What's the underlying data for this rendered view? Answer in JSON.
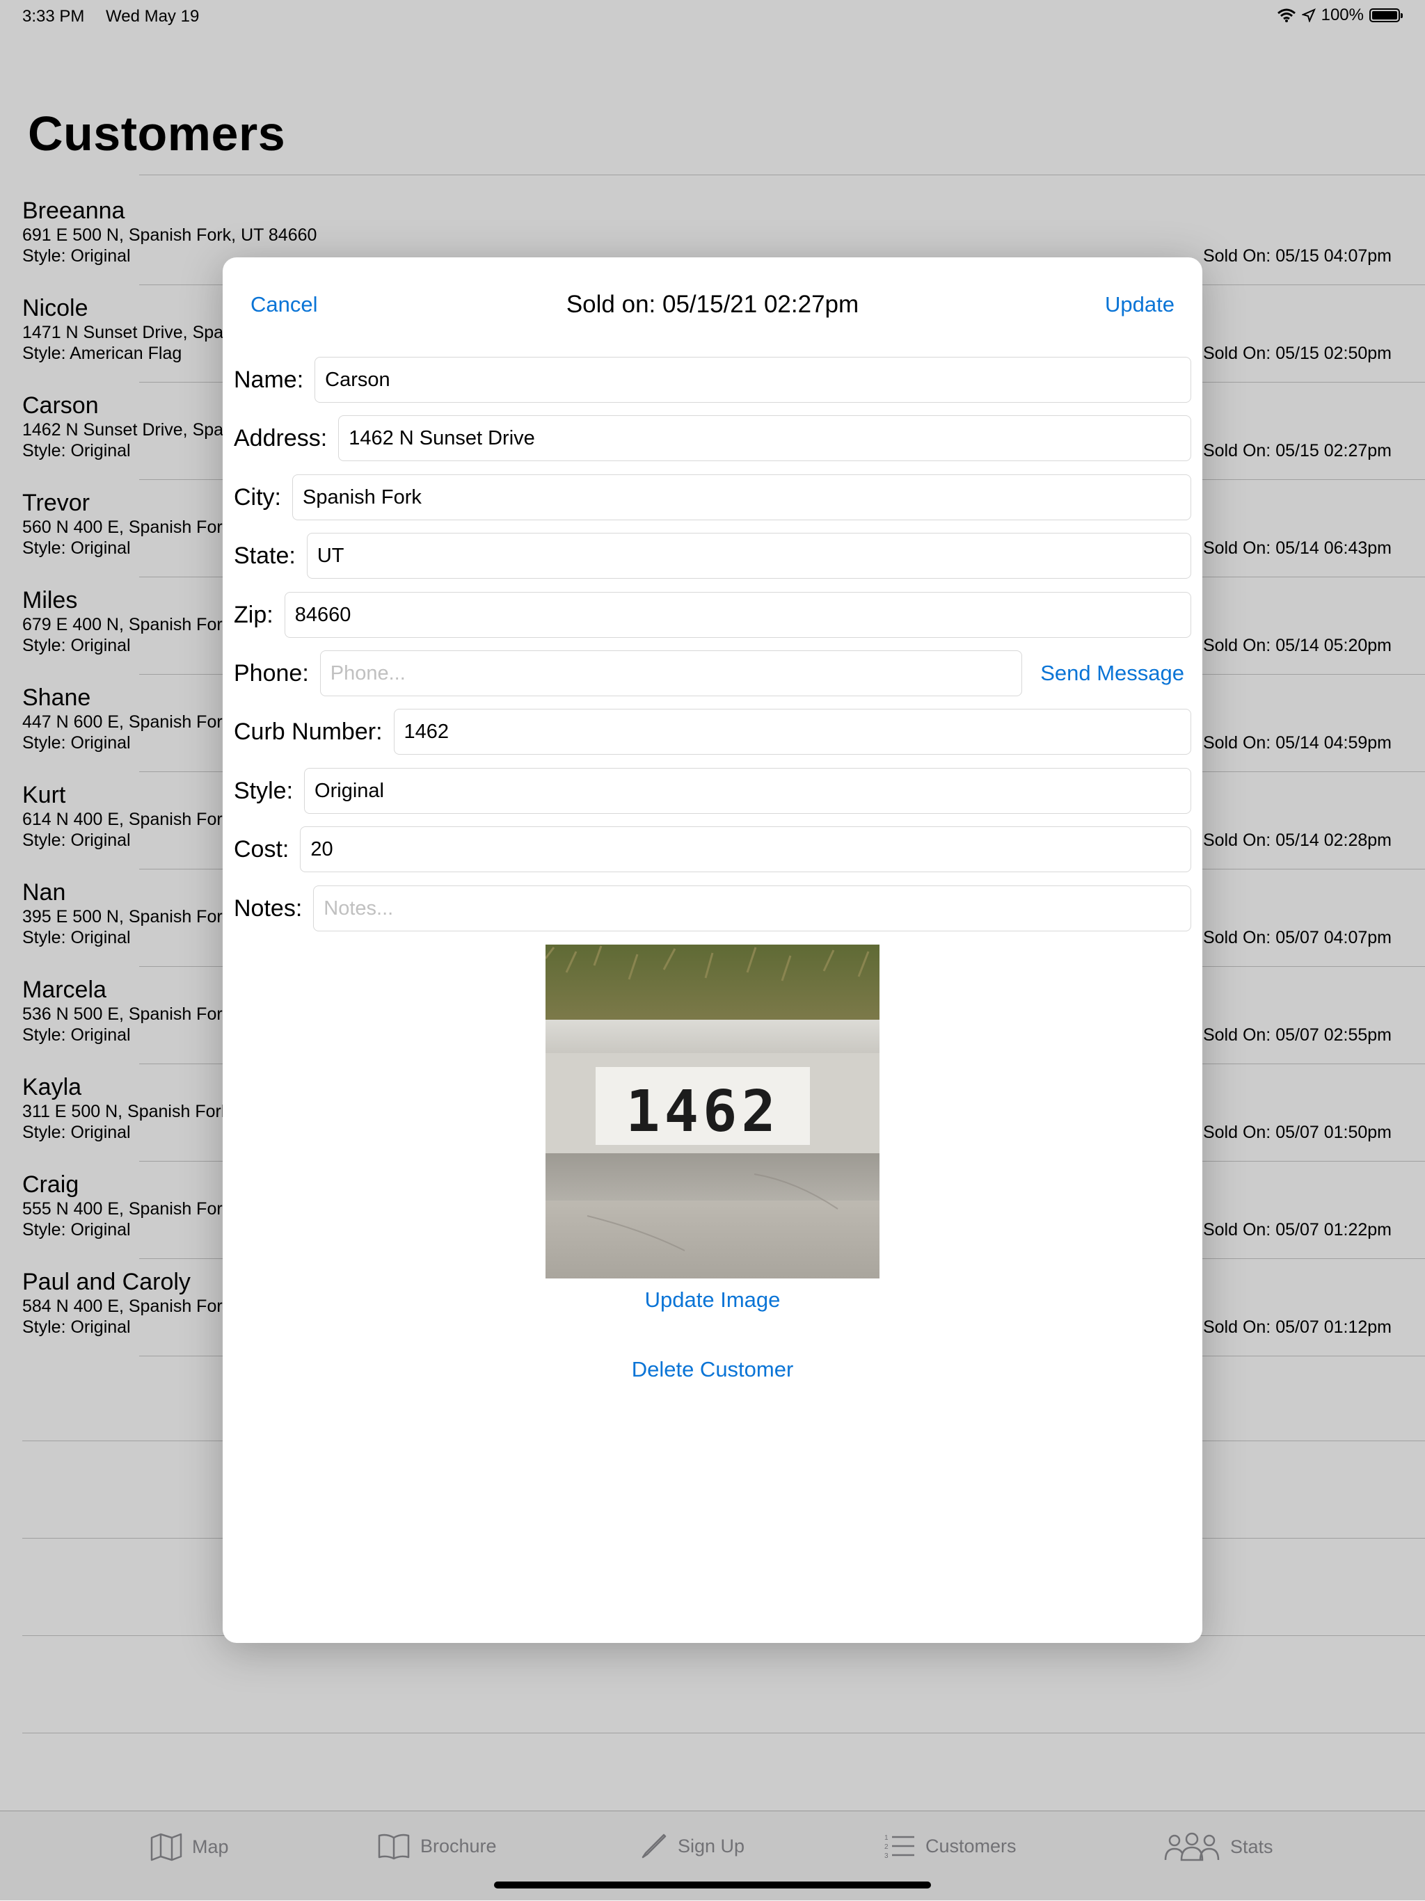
{
  "status_bar": {
    "time": "3:33 PM",
    "date": "Wed May 19",
    "battery": "100%"
  },
  "page": {
    "title": "Customers"
  },
  "customers": [
    {
      "name": "Breeanna",
      "address": "691 E 500 N, Spanish Fork, UT 84660",
      "style": "Style: Original",
      "sold": "Sold On: 05/15 04:07pm"
    },
    {
      "name": "Nicole",
      "address": "1471 N Sunset Drive, Spar",
      "style": "Style: American Flag",
      "sold": "Sold On: 05/15 02:50pm"
    },
    {
      "name": "Carson",
      "address": "1462 N Sunset Drive, Spa",
      "style": "Style: Original",
      "sold": "Sold On: 05/15 02:27pm"
    },
    {
      "name": "Trevor",
      "address": "560 N 400 E, Spanish For",
      "style": "Style: Original",
      "sold": "Sold On: 05/14 06:43pm"
    },
    {
      "name": "Miles",
      "address": "679 E 400 N, Spanish For",
      "style": "Style: Original",
      "sold": "Sold On: 05/14 05:20pm"
    },
    {
      "name": "Shane",
      "address": "447 N 600 E, Spanish For",
      "style": "Style: Original",
      "sold": "Sold On: 05/14 04:59pm"
    },
    {
      "name": "Kurt",
      "address": "614 N 400 E, Spanish For",
      "style": "Style: Original",
      "sold": "Sold On: 05/14 02:28pm"
    },
    {
      "name": "Nan",
      "address": "395 E 500 N, Spanish For",
      "style": "Style: Original",
      "sold": "Sold On: 05/07 04:07pm"
    },
    {
      "name": "Marcela",
      "address": "536 N 500 E, Spanish For",
      "style": "Style: Original",
      "sold": "Sold On: 05/07 02:55pm"
    },
    {
      "name": "Kayla",
      "address": "311 E 500 N, Spanish Fork",
      "style": "Style: Original",
      "sold": "Sold On: 05/07 01:50pm"
    },
    {
      "name": "Craig",
      "address": "555 N 400 E, Spanish For",
      "style": "Style: Original",
      "sold": "Sold On: 05/07 01:22pm"
    },
    {
      "name": "Paul and Caroly",
      "address": "584 N 400 E, Spanish For",
      "style": "Style: Original",
      "sold": "Sold On: 05/07 01:12pm"
    }
  ],
  "modal": {
    "cancel": "Cancel",
    "title": "Sold on: 05/15/21 02:27pm",
    "update": "Update",
    "fields": {
      "name": {
        "label": "Name:",
        "value": "Carson"
      },
      "address": {
        "label": "Address:",
        "value": "1462 N Sunset Drive"
      },
      "city": {
        "label": "City:",
        "value": "Spanish Fork"
      },
      "state": {
        "label": "State:",
        "value": "UT"
      },
      "zip": {
        "label": "Zip:",
        "value": "84660"
      },
      "phone": {
        "label": "Phone:",
        "placeholder": "Phone..."
      },
      "curb": {
        "label": "Curb Number:",
        "value": "1462"
      },
      "style": {
        "label": "Style:",
        "value": "Original"
      },
      "cost": {
        "label": "Cost:",
        "value": "20"
      },
      "notes": {
        "label": "Notes:",
        "placeholder": "Notes..."
      }
    },
    "send_message": "Send Message",
    "photo_number": "1462",
    "update_image": "Update Image",
    "delete_customer": "Delete Customer"
  },
  "tabs": [
    {
      "label": "Map",
      "icon": "map-icon"
    },
    {
      "label": "Brochure",
      "icon": "book-icon"
    },
    {
      "label": "Sign Up",
      "icon": "pencil-icon"
    },
    {
      "label": "Customers",
      "icon": "list-icon"
    },
    {
      "label": "Stats",
      "icon": "people-icon"
    }
  ],
  "colors": {
    "accent": "#0a74d6",
    "tab_inactive": "#8e8e93"
  }
}
